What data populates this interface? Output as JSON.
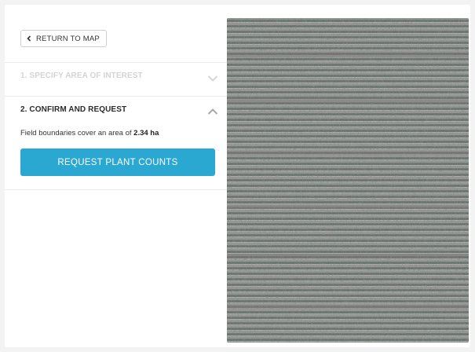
{
  "panel": {
    "back_button": {
      "label": "RETURN TO MAP",
      "icon": "chevron-left-icon"
    },
    "steps": [
      {
        "label": "1. SPECIFY AREA OF INTEREST",
        "state": "collapsed",
        "icon": "chevron-down-icon"
      },
      {
        "label": "2. CONFIRM AND REQUEST",
        "state": "expanded",
        "icon": "chevron-up-icon"
      }
    ],
    "area_text_prefix": "Field boundaries cover an area of",
    "area_value": "2.34 ha",
    "request_button": {
      "label": "REQUEST PLANT COUNTS"
    }
  },
  "colors": {
    "accent": "#2aa8d2",
    "disabled_text": "#d4d4d4",
    "background": "#f3f3f3"
  },
  "map": {
    "image": "aerial-field-image"
  }
}
